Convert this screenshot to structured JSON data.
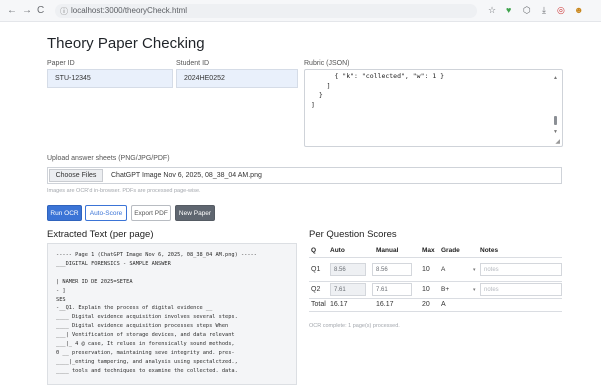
{
  "browser": {
    "back_icon": "←",
    "forward_icon": "→",
    "reload_icon": "C",
    "info_icon": "ⓘ",
    "url": "localhost:3000/theoryCheck.html",
    "star_icon": "☆",
    "ext_icon": "♥",
    "puzzle_icon": "⬡",
    "download_icon": "⤓",
    "pdf_icon": "◎",
    "avatar_icon": "☻"
  },
  "page": {
    "title": "Theory Paper Checking"
  },
  "form": {
    "paper_id_label": "Paper ID",
    "paper_id_value": "STU-12345",
    "student_id_label": "Student ID",
    "student_id_value": "2024HE0252",
    "rubric_label": "Rubric (JSON)",
    "rubric_text": "      { \"k\": \"collected\", \"w\": 1 }\n    ]\n  }\n]"
  },
  "upload": {
    "label": "Upload answer sheets (PNG/JPG/PDF)",
    "button_label": "Choose Files",
    "file_name": "ChatGPT Image Nov 6, 2025, 08_38_04 AM.png",
    "hint": "Images are OCR'd in-browser. PDFs are processed page-wise."
  },
  "actions": {
    "run_ocr": "Run OCR",
    "auto_score": "Auto-Score",
    "export_pdf": "Export PDF",
    "new_paper": "New Paper"
  },
  "extracted": {
    "heading": "Extracted Text (per page)",
    "text": "----- Page 1 (ChatGPT Image Nov 6, 2025, 08_38_04 AM.png) -----\n___DIGITAL FORENSICS - SAMPLE ANSWER\n\n| NAMER ID DE 2025=SETEA\n- ]\nSES\n-__Q1. Explain the process of digital evidence __\n____ Digital evidence acquisition involves several steps.\n____ Digital evidence acquisition processes steps When\n___| Ventification of storage devices, and data relevant\n___|_ 4 @ case, It relues in forensically sound methods,\n0 __ preservation, maintaining seve integrity and. pres-\n____|_enting tampering, and analysis using spectalctzed.,\n____ tools and techniques to examine the collected. data."
  },
  "scores": {
    "heading": "Per Question Scores",
    "columns": {
      "q": "Q",
      "auto": "Auto",
      "manual": "Manual",
      "max": "Max",
      "grade": "Grade",
      "notes": "Notes"
    },
    "rows": [
      {
        "q": "Q1",
        "auto": "8.56",
        "manual": "8.56",
        "max": "10",
        "grade": "A",
        "notes_placeholder": "notes"
      },
      {
        "q": "Q2",
        "auto": "7.61",
        "manual": "7.61",
        "max": "10",
        "grade": "B+",
        "notes_placeholder": "notes"
      }
    ],
    "total": {
      "label": "Total",
      "auto": "16.17",
      "manual": "16.17",
      "max": "20",
      "grade": "A"
    },
    "footnote": "OCR complete: 1 page(s) processed."
  }
}
